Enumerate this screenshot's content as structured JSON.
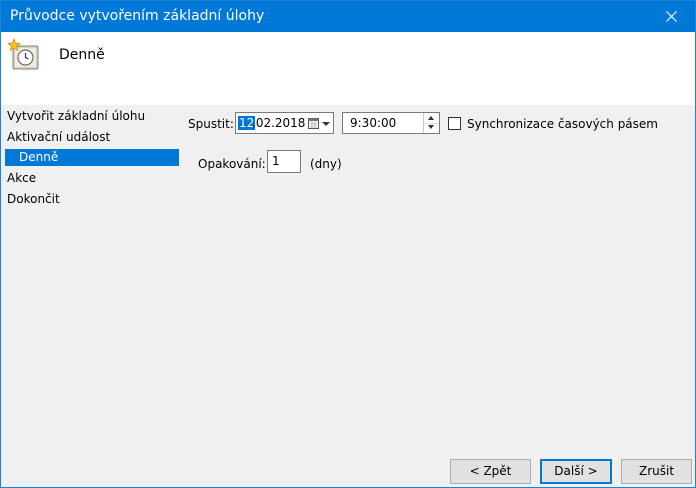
{
  "window": {
    "title": "Průvodce vytvořením základní úlohy"
  },
  "header": {
    "title": "Denně"
  },
  "nav": {
    "items": [
      {
        "label": "Vytvořit základní úlohu"
      },
      {
        "label": "Aktivační událost"
      },
      {
        "label": "Denně",
        "selected": true
      },
      {
        "label": "Akce"
      },
      {
        "label": "Dokončit"
      }
    ]
  },
  "form": {
    "start_label": "Spustit:",
    "date_day": "12",
    "date_rest": ".02.2018",
    "time_value": "9:30:00",
    "sync_label": "Synchronizace časových pásem",
    "sync_checked": false,
    "repeat_label": "Opakování:",
    "repeat_value": "1",
    "repeat_unit": "(dny)"
  },
  "buttons": {
    "back": "< Zpět",
    "next": "Další >",
    "cancel": "Zrušit"
  },
  "colors": {
    "accent": "#0078d7",
    "background": "#f0f0f0"
  },
  "icons": {
    "header": "task-scheduler-clock-icon",
    "close": "close-icon",
    "calendar": "calendar-icon"
  }
}
